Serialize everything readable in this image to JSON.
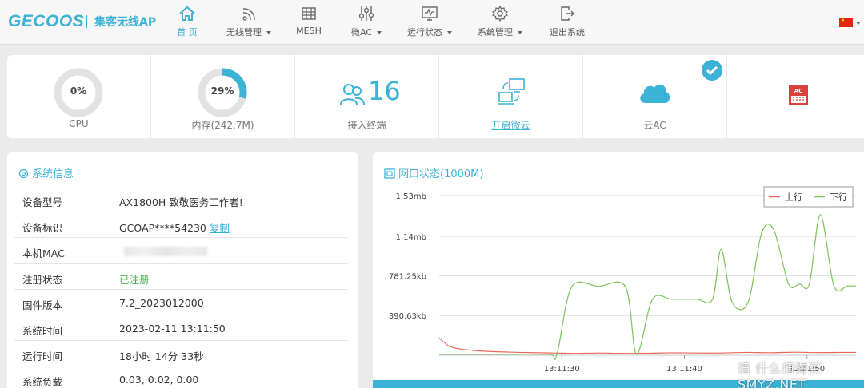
{
  "header": {
    "logo": "GECOOS",
    "subtitle": "集客无线AP",
    "nav": [
      {
        "label": "首 页",
        "icon": "home-icon",
        "active": true,
        "dropdown": false
      },
      {
        "label": "无线管理",
        "icon": "wifi-icon",
        "active": false,
        "dropdown": true
      },
      {
        "label": "MESH",
        "icon": "mesh-icon",
        "active": false,
        "dropdown": false
      },
      {
        "label": "微AC",
        "icon": "sliders-icon",
        "active": false,
        "dropdown": true
      },
      {
        "label": "运行状态",
        "icon": "monitor-icon",
        "active": false,
        "dropdown": true
      },
      {
        "label": "系统管理",
        "icon": "gear-icon",
        "active": false,
        "dropdown": true
      },
      {
        "label": "退出系统",
        "icon": "logout-icon",
        "active": false,
        "dropdown": false
      }
    ]
  },
  "stats": {
    "cpu": {
      "value": "0%",
      "label": "CPU",
      "percent": 0
    },
    "memory": {
      "value": "29%",
      "label": "内存(242.7M)",
      "percent": 29
    },
    "clients": {
      "value": "16",
      "label": "接入终端"
    },
    "micro_cloud": {
      "label": "开启微云"
    },
    "cloud_ac": {
      "label": "云AC"
    },
    "ac_icon": "ac-device-icon"
  },
  "system_info": {
    "title": "系统信息",
    "rows": [
      {
        "key": "设备型号",
        "value": "AX1800H 致敬医务工作者!"
      },
      {
        "key": "设备标识",
        "value": "GCOAP****54230",
        "action": "复制"
      },
      {
        "key": "本机MAC",
        "value": ""
      },
      {
        "key": "注册状态",
        "value": "已注册"
      },
      {
        "key": "固件版本",
        "value": "7.2_2023012000"
      },
      {
        "key": "系统时间",
        "value": "2023-02-11 13:11:50"
      },
      {
        "key": "运行时间",
        "value": "18小时 14分 33秒"
      },
      {
        "key": "系统负载",
        "value": "0.03, 0.02, 0.00"
      }
    ]
  },
  "colors": {
    "accent": "#3bb2d6",
    "upload": "#e8675a",
    "download": "#7cc35a"
  },
  "chart_data": {
    "type": "line",
    "title": "网口状态(1000M)",
    "y_ticks": [
      "1.53mb",
      "1.14mb",
      "781.25kb",
      "390.63kb"
    ],
    "y_tick_values": [
      1566.72,
      1167.36,
      781.25,
      390.63
    ],
    "ylim": [
      0,
      1566.72
    ],
    "y_unit": "kb",
    "x_ticks": [
      "13:11:30",
      "13:11:40",
      "13:11:50"
    ],
    "x_tick_values": [
      10.0,
      20.0,
      30.0
    ],
    "xlim": [
      0,
      34
    ],
    "legend_position": "top-right",
    "grid": true,
    "series": [
      {
        "name": "上行",
        "color": "#e8675a",
        "x": [
          0,
          0.8,
          1.8,
          3,
          4.5,
          6.5,
          8,
          9.5,
          11,
          13,
          15,
          17,
          19,
          21,
          23,
          25,
          27,
          29,
          31,
          33,
          34
        ],
        "y": [
          170,
          90,
          60,
          45,
          35,
          28,
          25,
          22,
          18,
          22,
          18,
          20,
          24,
          22,
          22,
          28,
          25,
          30,
          26,
          28,
          28
        ]
      },
      {
        "name": "下行",
        "color": "#7cc35a",
        "x": [
          0,
          3,
          6,
          9,
          9.6,
          10.8,
          13,
          15.2,
          16.1,
          17.4,
          19,
          21,
          22.3,
          23,
          23.9,
          25.2,
          26.3,
          27.3,
          28.5,
          29.4,
          30.2,
          31.1,
          32.2,
          33.3,
          34
        ],
        "y": [
          10,
          10,
          10,
          10,
          5,
          670,
          675,
          670,
          10,
          550,
          550,
          550,
          550,
          1040,
          520,
          520,
          1200,
          1230,
          700,
          700,
          700,
          1380,
          680,
          680,
          680
        ]
      }
    ]
  },
  "watermark": "值 什么值得买 SMYZ.NET"
}
